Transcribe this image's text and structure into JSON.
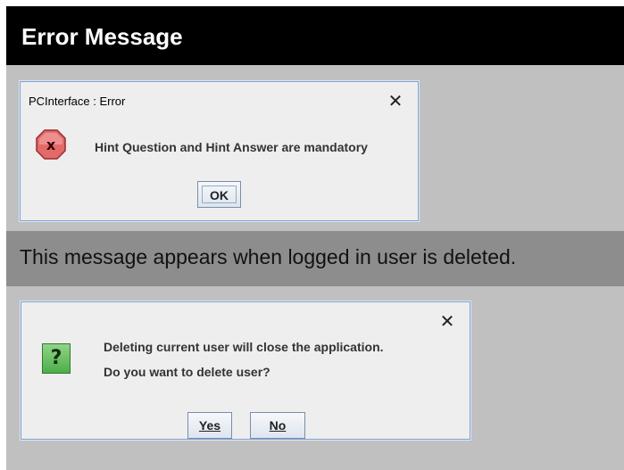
{
  "page": {
    "heading": "Error Message",
    "caption": "This message appears when logged in user is deleted."
  },
  "error_dialog": {
    "title": "PCInterface : Error",
    "close_glyph": "✕",
    "icon": "error-icon",
    "message": "Hint Question and Hint Answer are mandatory",
    "ok_label": "OK"
  },
  "confirm_dialog": {
    "title": "",
    "close_glyph": "✕",
    "icon": "question-icon",
    "icon_glyph": "?",
    "message_line1": "Deleting current user will close the application.",
    "message_line2": "Do you want to delete user?",
    "yes_label": "Yes",
    "no_label": "No"
  },
  "colors": {
    "header_bg": "#000000",
    "panel_bg": "#c0c0c0",
    "caption_bg": "#8d8d8d",
    "dialog_bg": "#eeeeee",
    "error_red": "#e05454",
    "question_green": "#4eae48"
  }
}
